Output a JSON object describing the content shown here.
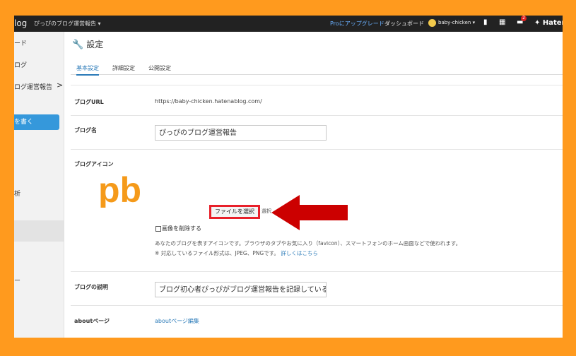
{
  "topbar": {
    "brand": "log",
    "blog_select": "ぴっぴのブログ運営報告 ▾",
    "pro_upgrade": "Proにアップグレード",
    "dashboard": "ダッシュボード",
    "username": "baby-chicken ▾",
    "notification_count": "2",
    "logo": "✦ Haten"
  },
  "sidebar": {
    "items": [
      "ード",
      "ログ",
      "ログ運営報告",
      "を書く",
      "析",
      "ー"
    ],
    "chevron": ">"
  },
  "page": {
    "title": "設定",
    "tabs": [
      "基本設定",
      "詳細設定",
      "公開設定"
    ]
  },
  "form": {
    "blog_url_label": "ブログURL",
    "blog_url_value": "https://baby-chicken.hatenablog.com/",
    "blog_name_label": "ブログ名",
    "blog_name_value": "ぴっぴのブログ運営報告",
    "blog_icon_label": "ブログアイコン",
    "icon_text": "pb",
    "file_button": "ファイルを選択",
    "file_status": "選択",
    "delete_image": "画像を削除する",
    "help_text": "あなたのブログを表すアイコンです。ブラウザのタブやお気に入り（favicon）、スマートフォンのホーム画面などで使われます。",
    "formats_text": "※ 対応しているファイル形式は、JPEG、PNGです。",
    "more_link": "詳しくはこちら",
    "description_label": "ブログの説明",
    "description_value": "ブログ初心者ぴっぴがブログ運営報告を記録しているも",
    "about_label": "aboutページ",
    "about_link": "aboutページ編集"
  },
  "colors": {
    "border": "#FF9A1E",
    "topbar": "#222222",
    "accent": "#3598db",
    "highlight": "#e8202a",
    "arrow": "#cc0000"
  }
}
